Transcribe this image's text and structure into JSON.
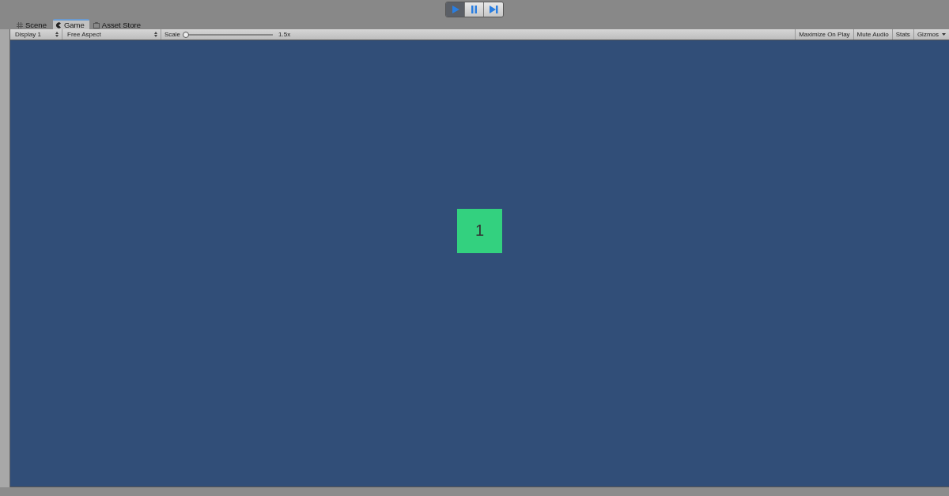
{
  "play_controls": [
    {
      "kind": "play",
      "selected": true
    },
    {
      "kind": "pause",
      "selected": false
    },
    {
      "kind": "step",
      "selected": false
    }
  ],
  "tabs": [
    {
      "label": "Scene",
      "kind": "grid",
      "selected": false
    },
    {
      "label": "Game",
      "kind": "pacman",
      "selected": true
    },
    {
      "label": "Asset Store",
      "kind": "store",
      "selected": false
    }
  ],
  "toolbar": {
    "display": "Display 1",
    "aspect": "Free Aspect",
    "scale_label": "Scale",
    "scale": {
      "level": 0.0
    },
    "scale_reading": "1.5x",
    "buttons": [
      {
        "label": "Maximize On Play",
        "dropdown": false
      },
      {
        "label": "Mute Audio",
        "dropdown": false
      },
      {
        "label": "Stats",
        "dropdown": false
      },
      {
        "label": "Gizmos",
        "dropdown": true
      }
    ]
  },
  "game_view": {
    "tile": {
      "label": "1",
      "color": "#33d17f"
    }
  }
}
